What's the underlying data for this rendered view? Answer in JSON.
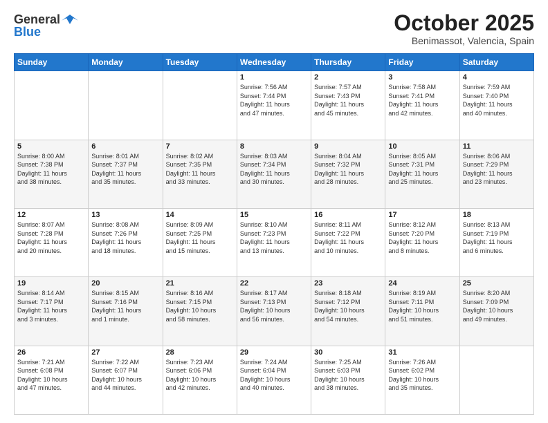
{
  "header": {
    "logo_general": "General",
    "logo_blue": "Blue",
    "month": "October 2025",
    "location": "Benimassot, Valencia, Spain"
  },
  "days_of_week": [
    "Sunday",
    "Monday",
    "Tuesday",
    "Wednesday",
    "Thursday",
    "Friday",
    "Saturday"
  ],
  "weeks": [
    [
      {
        "day": "",
        "info": ""
      },
      {
        "day": "",
        "info": ""
      },
      {
        "day": "",
        "info": ""
      },
      {
        "day": "1",
        "info": "Sunrise: 7:56 AM\nSunset: 7:44 PM\nDaylight: 11 hours\nand 47 minutes."
      },
      {
        "day": "2",
        "info": "Sunrise: 7:57 AM\nSunset: 7:43 PM\nDaylight: 11 hours\nand 45 minutes."
      },
      {
        "day": "3",
        "info": "Sunrise: 7:58 AM\nSunset: 7:41 PM\nDaylight: 11 hours\nand 42 minutes."
      },
      {
        "day": "4",
        "info": "Sunrise: 7:59 AM\nSunset: 7:40 PM\nDaylight: 11 hours\nand 40 minutes."
      }
    ],
    [
      {
        "day": "5",
        "info": "Sunrise: 8:00 AM\nSunset: 7:38 PM\nDaylight: 11 hours\nand 38 minutes."
      },
      {
        "day": "6",
        "info": "Sunrise: 8:01 AM\nSunset: 7:37 PM\nDaylight: 11 hours\nand 35 minutes."
      },
      {
        "day": "7",
        "info": "Sunrise: 8:02 AM\nSunset: 7:35 PM\nDaylight: 11 hours\nand 33 minutes."
      },
      {
        "day": "8",
        "info": "Sunrise: 8:03 AM\nSunset: 7:34 PM\nDaylight: 11 hours\nand 30 minutes."
      },
      {
        "day": "9",
        "info": "Sunrise: 8:04 AM\nSunset: 7:32 PM\nDaylight: 11 hours\nand 28 minutes."
      },
      {
        "day": "10",
        "info": "Sunrise: 8:05 AM\nSunset: 7:31 PM\nDaylight: 11 hours\nand 25 minutes."
      },
      {
        "day": "11",
        "info": "Sunrise: 8:06 AM\nSunset: 7:29 PM\nDaylight: 11 hours\nand 23 minutes."
      }
    ],
    [
      {
        "day": "12",
        "info": "Sunrise: 8:07 AM\nSunset: 7:28 PM\nDaylight: 11 hours\nand 20 minutes."
      },
      {
        "day": "13",
        "info": "Sunrise: 8:08 AM\nSunset: 7:26 PM\nDaylight: 11 hours\nand 18 minutes."
      },
      {
        "day": "14",
        "info": "Sunrise: 8:09 AM\nSunset: 7:25 PM\nDaylight: 11 hours\nand 15 minutes."
      },
      {
        "day": "15",
        "info": "Sunrise: 8:10 AM\nSunset: 7:23 PM\nDaylight: 11 hours\nand 13 minutes."
      },
      {
        "day": "16",
        "info": "Sunrise: 8:11 AM\nSunset: 7:22 PM\nDaylight: 11 hours\nand 10 minutes."
      },
      {
        "day": "17",
        "info": "Sunrise: 8:12 AM\nSunset: 7:20 PM\nDaylight: 11 hours\nand 8 minutes."
      },
      {
        "day": "18",
        "info": "Sunrise: 8:13 AM\nSunset: 7:19 PM\nDaylight: 11 hours\nand 6 minutes."
      }
    ],
    [
      {
        "day": "19",
        "info": "Sunrise: 8:14 AM\nSunset: 7:17 PM\nDaylight: 11 hours\nand 3 minutes."
      },
      {
        "day": "20",
        "info": "Sunrise: 8:15 AM\nSunset: 7:16 PM\nDaylight: 11 hours\nand 1 minute."
      },
      {
        "day": "21",
        "info": "Sunrise: 8:16 AM\nSunset: 7:15 PM\nDaylight: 10 hours\nand 58 minutes."
      },
      {
        "day": "22",
        "info": "Sunrise: 8:17 AM\nSunset: 7:13 PM\nDaylight: 10 hours\nand 56 minutes."
      },
      {
        "day": "23",
        "info": "Sunrise: 8:18 AM\nSunset: 7:12 PM\nDaylight: 10 hours\nand 54 minutes."
      },
      {
        "day": "24",
        "info": "Sunrise: 8:19 AM\nSunset: 7:11 PM\nDaylight: 10 hours\nand 51 minutes."
      },
      {
        "day": "25",
        "info": "Sunrise: 8:20 AM\nSunset: 7:09 PM\nDaylight: 10 hours\nand 49 minutes."
      }
    ],
    [
      {
        "day": "26",
        "info": "Sunrise: 7:21 AM\nSunset: 6:08 PM\nDaylight: 10 hours\nand 47 minutes."
      },
      {
        "day": "27",
        "info": "Sunrise: 7:22 AM\nSunset: 6:07 PM\nDaylight: 10 hours\nand 44 minutes."
      },
      {
        "day": "28",
        "info": "Sunrise: 7:23 AM\nSunset: 6:06 PM\nDaylight: 10 hours\nand 42 minutes."
      },
      {
        "day": "29",
        "info": "Sunrise: 7:24 AM\nSunset: 6:04 PM\nDaylight: 10 hours\nand 40 minutes."
      },
      {
        "day": "30",
        "info": "Sunrise: 7:25 AM\nSunset: 6:03 PM\nDaylight: 10 hours\nand 38 minutes."
      },
      {
        "day": "31",
        "info": "Sunrise: 7:26 AM\nSunset: 6:02 PM\nDaylight: 10 hours\nand 35 minutes."
      },
      {
        "day": "",
        "info": ""
      }
    ]
  ]
}
